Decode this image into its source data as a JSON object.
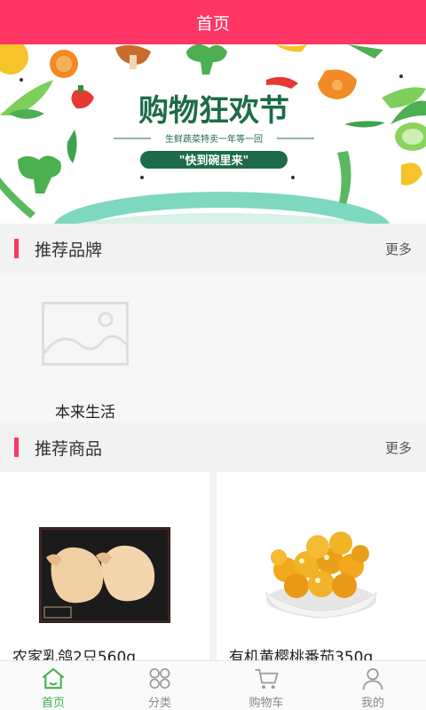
{
  "header": {
    "title": "首页"
  },
  "banner": {
    "headline": "购物狂欢节",
    "subline": "生鲜蔬菜特卖一年等一回",
    "tag": "\"快到碗里来\""
  },
  "brands_section": {
    "title": "推荐品牌",
    "more": "更多",
    "items": [
      {
        "name": "本来生活",
        "icon": "image-placeholder-icon"
      }
    ]
  },
  "products_section": {
    "title": "推荐商品",
    "more": "更多",
    "items": [
      {
        "name": "农家乳鸽2只560g"
      },
      {
        "name": "有机黄樱桃番茄350g"
      }
    ]
  },
  "tabbar": {
    "active": "home",
    "active_color": "#3cae4a",
    "items": [
      {
        "label": "首页",
        "icon": "home-icon"
      },
      {
        "label": "分类",
        "icon": "category-icon"
      },
      {
        "label": "购物车",
        "icon": "cart-icon"
      },
      {
        "label": "我的",
        "icon": "user-icon"
      }
    ]
  },
  "colors": {
    "brand": "#ff3565",
    "banner_text": "#1d6b4a"
  }
}
